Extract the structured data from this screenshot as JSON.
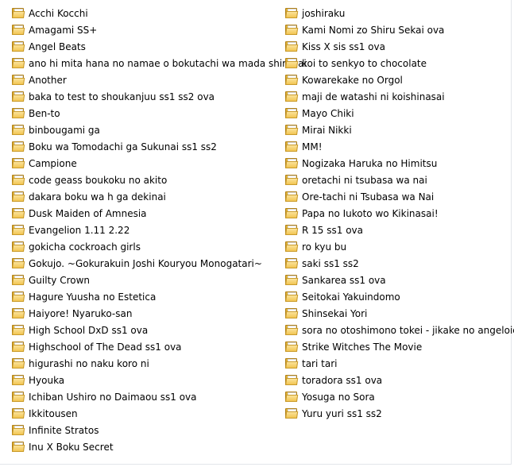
{
  "folders": [
    [
      "Acchi Kocchi",
      "Amagami SS+",
      "Angel Beats",
      "ano hi mita hana no namae o bokutachi wa mada shiranai",
      "Another",
      "baka to test to shoukanjuu ss1 ss2 ova",
      "Ben-to",
      "binbougami ga",
      "Boku wa Tomodachi ga Sukunai ss1 ss2",
      "Campione",
      "code geass boukoku no akito",
      "dakara boku wa h ga dekinai",
      "Dusk Maiden of Amnesia",
      "Evangelion 1.11 2.22",
      "gokicha cockroach girls",
      "Gokujo. ~Gokurakuin Joshi Kouryou Monogatari~",
      "Guilty Crown",
      "Hagure Yuusha no Estetica",
      "Haiyore! Nyaruko-san",
      "High School DxD ss1 ova",
      "Highschool of The Dead ss1 ova",
      "higurashi no naku koro ni",
      "Hyouka",
      "Ichiban Ushiro no Daimaou ss1 ova",
      "Ikkitousen",
      "Infinite Stratos",
      "Inu X Boku Secret"
    ],
    [
      "joshiraku",
      "Kami Nomi zo Shiru Sekai ova",
      "Kiss X sis ss1 ova",
      "koi to senkyo to chocolate",
      "Kowarekake no Orgol",
      "maji de watashi ni koishinasai",
      "Mayo Chiki",
      "Mirai Nikki",
      "MM!",
      "Nogizaka Haruka no Himitsu",
      "oretachi ni tsubasa wa nai",
      "Ore-tachi ni Tsubasa wa Nai",
      "Papa no Iukoto wo Kikinasai!",
      "R 15 ss1 ova",
      "ro kyu bu",
      "saki ss1 ss2",
      "Sankarea ss1 ova",
      "Seitokai Yakuindomo",
      "Shinsekai Yori",
      "sora no otoshimono tokei - jikake no angeloid",
      "Strike Witches The Movie",
      "tari tari",
      "toradora ss1 ova",
      "Yosuga no Sora",
      "Yuru yuri ss1 ss2"
    ]
  ],
  "icon": "folder-icon",
  "colors": {
    "folder_back": "#d4a32c",
    "folder_front": "#f6d477",
    "background": "#ffffff"
  }
}
